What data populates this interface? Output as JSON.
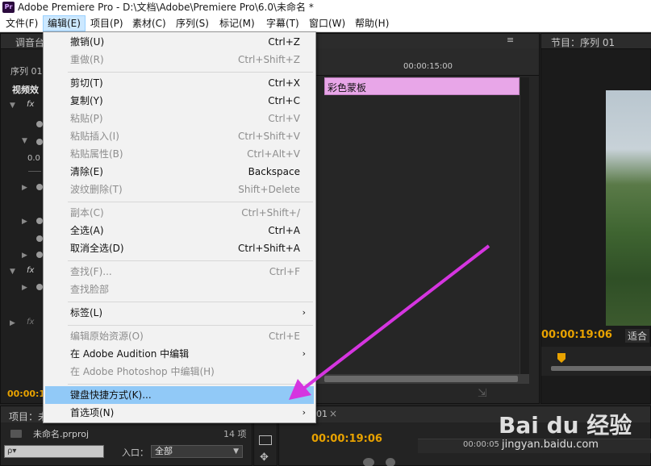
{
  "title_bar": {
    "app_icon": "Pr",
    "title": "Adobe Premiere Pro - D:\\文档\\Adobe\\Premiere Pro\\6.0\\未命名 *"
  },
  "menubar": [
    {
      "label": "文件(F)"
    },
    {
      "label": "编辑(E)"
    },
    {
      "label": "项目(P)"
    },
    {
      "label": "素材(C)"
    },
    {
      "label": "序列(S)"
    },
    {
      "label": "标记(M)"
    },
    {
      "label": "字幕(T)"
    },
    {
      "label": "窗口(W)"
    },
    {
      "label": "帮助(H)"
    }
  ],
  "edit_menu": {
    "items": [
      {
        "label": "撤销(U)",
        "shortcut": "Ctrl+Z",
        "disabled": false
      },
      {
        "label": "重做(R)",
        "shortcut": "Ctrl+Shift+Z",
        "disabled": true
      },
      {
        "label": "剪切(T)",
        "shortcut": "Ctrl+X",
        "disabled": false
      },
      {
        "label": "复制(Y)",
        "shortcut": "Ctrl+C",
        "disabled": false
      },
      {
        "label": "粘贴(P)",
        "shortcut": "Ctrl+V",
        "disabled": true
      },
      {
        "label": "粘贴插入(I)",
        "shortcut": "Ctrl+Shift+V",
        "disabled": true
      },
      {
        "label": "粘贴属性(B)",
        "shortcut": "Ctrl+Alt+V",
        "disabled": true
      },
      {
        "label": "清除(E)",
        "shortcut": "Backspace",
        "disabled": false
      },
      {
        "label": "波纹删除(T)",
        "shortcut": "Shift+Delete",
        "disabled": true
      },
      {
        "label": "副本(C)",
        "shortcut": "Ctrl+Shift+/",
        "disabled": true
      },
      {
        "label": "全选(A)",
        "shortcut": "Ctrl+A",
        "disabled": false
      },
      {
        "label": "取消全选(D)",
        "shortcut": "Ctrl+Shift+A",
        "disabled": false
      },
      {
        "label": "查找(F)...",
        "shortcut": "Ctrl+F",
        "disabled": true
      },
      {
        "label": "查找脸部",
        "shortcut": "",
        "disabled": true
      },
      {
        "label": "标签(L)",
        "shortcut": "",
        "disabled": false,
        "submenu": true
      },
      {
        "label": "编辑原始资源(O)",
        "shortcut": "Ctrl+E",
        "disabled": true
      },
      {
        "label": "在 Adobe Audition 中编辑",
        "shortcut": "",
        "disabled": false,
        "submenu": true
      },
      {
        "label": "在 Adobe Photoshop 中编辑(H)",
        "shortcut": "",
        "disabled": true
      },
      {
        "label": "键盘快捷方式(K)...",
        "shortcut": "",
        "disabled": false,
        "highlighted": true
      },
      {
        "label": "首选项(N)",
        "shortcut": "",
        "disabled": false,
        "submenu": true
      }
    ],
    "submenu_arrow": "›"
  },
  "panels": {
    "effect_controls": {
      "tab": "调音台",
      "seq_tab": "序列 01",
      "section_label": "视频效",
      "value_label": "0.0",
      "fx_label": "fx",
      "timecode": "00:00:1",
      "bottom_glyph": "Ø"
    },
    "timeline_ruler": {
      "time_label": "00:00:15:00",
      "clip_label": "彩色蒙板",
      "menu_icon": "≡"
    },
    "program_monitor": {
      "tab": "节目：序列 01",
      "timecode": "00:00:19:06",
      "fit_label": "适合"
    },
    "project_panel": {
      "tab": "项目：未命名",
      "file_name": "未命名.prproj",
      "item_count": "14 项",
      "search_placeholder": "ρ▾",
      "inlet_label": "入口：",
      "inlet_value": "全部"
    },
    "timeline": {
      "tab_suffix": "01",
      "close_glyph": "×",
      "timecode": "00:00:19:06",
      "ruler_time": "00:00:05"
    }
  },
  "watermark": {
    "logo": "Bai du 经验",
    "url": "jingyan.baidu.com"
  },
  "colors": {
    "accent_timecode": "#e8a200",
    "menu_hover": "#91c9f7",
    "clip_color": "#e8a6e8",
    "arrow_color": "#d535e0"
  }
}
